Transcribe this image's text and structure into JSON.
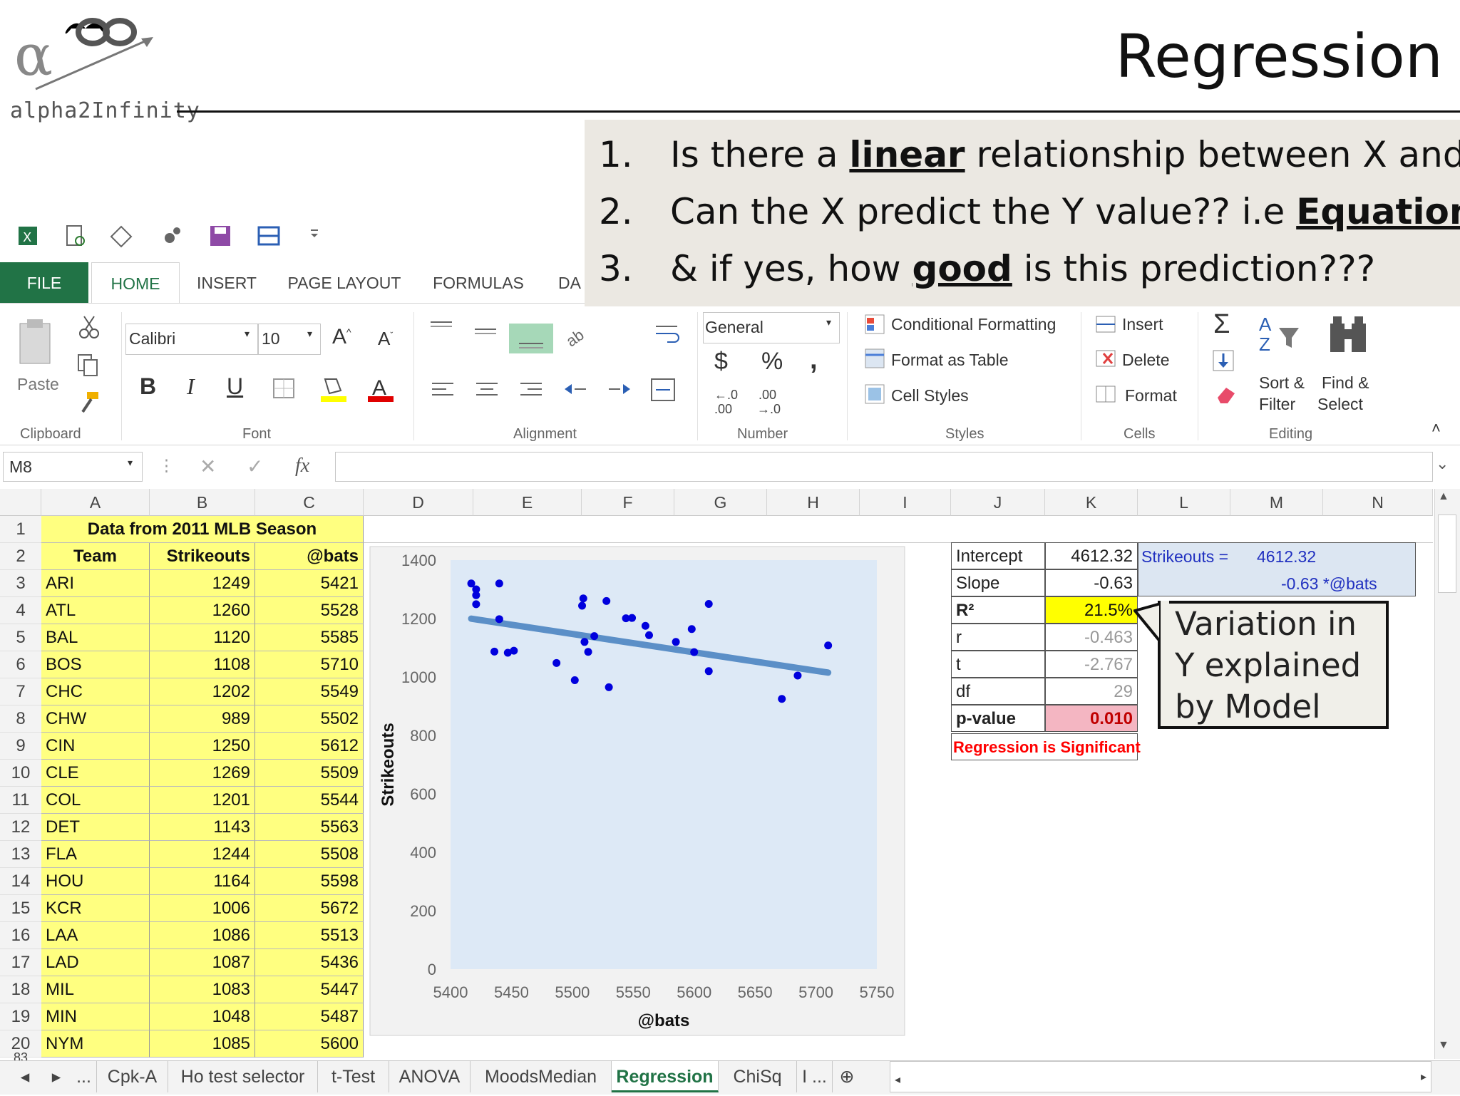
{
  "slide": {
    "logo_text": "alpha2Infinity",
    "title": "Regression",
    "questions": [
      {
        "num": "1.",
        "pre": "Is there a ",
        "bold": "linear",
        "post": " relationship between X and Y?"
      },
      {
        "num": "2.",
        "pre": "Can the X predict the Y value?? i.e ",
        "bold": "Equation",
        "post": ""
      },
      {
        "num": "3.",
        "pre": "& if yes, how ",
        "bold": "good",
        "post": " is this prediction???"
      }
    ]
  },
  "ribbon": {
    "tabs": [
      "FILE",
      "HOME",
      "INSERT",
      "PAGE LAYOUT",
      "FORMULAS",
      "DA"
    ],
    "clipboard": {
      "label": "Clipboard",
      "paste": "Paste"
    },
    "font": {
      "label": "Font",
      "name": "Calibri",
      "size": "10",
      "bold": "B",
      "italic": "I",
      "underline": "U"
    },
    "alignment": {
      "label": "Alignment"
    },
    "number": {
      "label": "Number",
      "format": "General",
      "currency": "$",
      "percent": "%",
      "comma": ",",
      "inc": ".0\n.00",
      "dec": ".00\n→.0"
    },
    "styles": {
      "label": "Styles",
      "cond": "Conditional Formatting",
      "table": "Format as Table",
      "cell": "Cell Styles"
    },
    "cells": {
      "label": "Cells",
      "insert": "Insert",
      "delete": "Delete",
      "format": "Format"
    },
    "editing": {
      "label": "Editing",
      "sort1": "Sort &",
      "sort2": "Filter",
      "find1": "Find &",
      "find2": "Select"
    }
  },
  "formula_bar": {
    "name_box": "M8",
    "fx": "fx",
    "content": ""
  },
  "sheet": {
    "columns": [
      "A",
      "B",
      "C",
      "D",
      "E",
      "F",
      "G",
      "H",
      "I",
      "J",
      "K",
      "L",
      "M",
      "N"
    ],
    "rows": [
      "1",
      "2",
      "3",
      "4",
      "5",
      "6",
      "7",
      "8",
      "9",
      "10",
      "11",
      "12",
      "13",
      "14",
      "15",
      "16",
      "17",
      "18",
      "19",
      "20"
    ],
    "data_title": "Data from 2011 MLB Season",
    "headers": [
      "Team",
      "Strikeouts",
      "@bats"
    ],
    "data": [
      [
        "ARI",
        "1249",
        "5421"
      ],
      [
        "ATL",
        "1260",
        "5528"
      ],
      [
        "BAL",
        "1120",
        "5585"
      ],
      [
        "BOS",
        "1108",
        "5710"
      ],
      [
        "CHC",
        "1202",
        "5549"
      ],
      [
        "CHW",
        "989",
        "5502"
      ],
      [
        "CIN",
        "1250",
        "5612"
      ],
      [
        "CLE",
        "1269",
        "5509"
      ],
      [
        "COL",
        "1201",
        "5544"
      ],
      [
        "DET",
        "1143",
        "5563"
      ],
      [
        "FLA",
        "1244",
        "5508"
      ],
      [
        "HOU",
        "1164",
        "5598"
      ],
      [
        "KCR",
        "1006",
        "5672"
      ],
      [
        "LAA",
        "1086",
        "5513"
      ],
      [
        "LAD",
        "1087",
        "5436"
      ],
      [
        "MIL",
        "1083",
        "5447"
      ],
      [
        "MIN",
        "1048",
        "5487"
      ],
      [
        "NYM",
        "1085",
        "5600"
      ]
    ],
    "row_overflow": "83"
  },
  "stats": {
    "rows": [
      {
        "label": "Intercept",
        "value": "4612.32"
      },
      {
        "label": "Slope",
        "value": "-0.63"
      },
      {
        "label": "R²",
        "value": "21.5%"
      },
      {
        "label": "r",
        "value": "-0.463"
      },
      {
        "label": "t",
        "value": "-2.767"
      },
      {
        "label": "df",
        "value": "29"
      },
      {
        "label": "p-value",
        "value": "0.010"
      }
    ],
    "conclusion": "Regression is Significant",
    "equation": {
      "lhs": "Strikeouts =",
      "intercept": "4612.32",
      "slope_term": "-0.63 *@bats"
    },
    "colors": {
      "r2": "#ffff00",
      "pvalue": "#f4b6c2",
      "equation": "#dce6f2",
      "conclusion": "#ff0000"
    }
  },
  "callout": {
    "text": "Variation in Y explained by Model"
  },
  "chart_data": {
    "type": "scatter",
    "xlabel": "@bats",
    "ylabel": "Strikeouts",
    "xlim": [
      5400,
      5750
    ],
    "ylim": [
      0,
      1400
    ],
    "xticks": [
      "5400",
      "5450",
      "5500",
      "5550",
      "5600",
      "5650",
      "5700",
      "5750"
    ],
    "yticks": [
      "0",
      "200",
      "400",
      "600",
      "800",
      "1000",
      "1200",
      "1400"
    ],
    "points": [
      [
        5417,
        1320
      ],
      [
        5421,
        1300
      ],
      [
        5421,
        1280
      ],
      [
        5421,
        1249
      ],
      [
        5436,
        1087
      ],
      [
        5440,
        1320
      ],
      [
        5440,
        1198
      ],
      [
        5447,
        1083
      ],
      [
        5452,
        1090
      ],
      [
        5487,
        1048
      ],
      [
        5502,
        989
      ],
      [
        5508,
        1244
      ],
      [
        5509,
        1269
      ],
      [
        5510,
        1120
      ],
      [
        5513,
        1086
      ],
      [
        5518,
        1140
      ],
      [
        5528,
        1260
      ],
      [
        5530,
        965
      ],
      [
        5544,
        1201
      ],
      [
        5549,
        1202
      ],
      [
        5563,
        1143
      ],
      [
        5560,
        1175
      ],
      [
        5585,
        1120
      ],
      [
        5598,
        1164
      ],
      [
        5600,
        1085
      ],
      [
        5612,
        1250
      ],
      [
        5612,
        1020
      ],
      [
        5685,
        1005
      ],
      [
        5672,
        925
      ],
      [
        5710,
        1108
      ]
    ],
    "trend": {
      "intercept": 4612.32,
      "slope": -0.63
    },
    "point_color": "#0000dd",
    "trend_color": "#5b8fc7",
    "plot_bg": "#dde9f6"
  }
}
